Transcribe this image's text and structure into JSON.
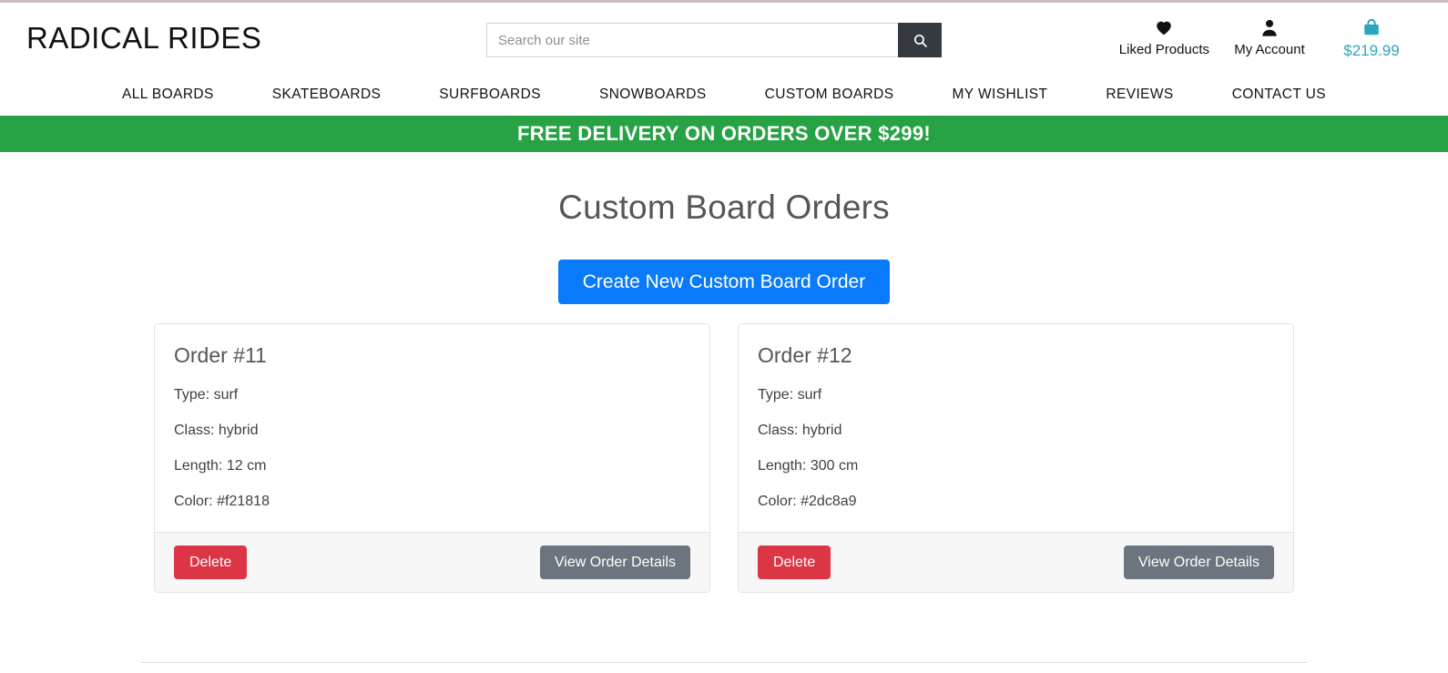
{
  "brand": {
    "name": "RADICAL RIDES"
  },
  "search": {
    "placeholder": "Search our site",
    "value": "",
    "button_icon": "search-icon"
  },
  "header_actions": [
    {
      "icon": "heart-icon",
      "label": "Liked Products"
    },
    {
      "icon": "user-icon",
      "label": "My Account"
    },
    {
      "icon": "shopping-bag-icon",
      "label": "$219.99",
      "color": "#2ba6bf"
    }
  ],
  "nav": {
    "items": [
      {
        "label": "ALL BOARDS"
      },
      {
        "label": "SKATEBOARDS"
      },
      {
        "label": "SURFBOARDS"
      },
      {
        "label": "SNOWBOARDS"
      },
      {
        "label": "CUSTOM BOARDS"
      },
      {
        "label": "MY WISHLIST"
      },
      {
        "label": "REVIEWS"
      },
      {
        "label": "CONTACT US"
      }
    ]
  },
  "banner": {
    "text": "FREE DELIVERY ON ORDERS OVER $299!",
    "background": "#27a244"
  },
  "main": {
    "title": "Custom Board Orders",
    "create_button": {
      "label": "Create New Custom Board Order",
      "color": "#097afa"
    }
  },
  "orders": [
    {
      "title": "Order #11",
      "type": "Type: surf",
      "class": "Class: hybrid",
      "length": "Length: 12 cm",
      "color": "Color: #f21818",
      "delete_label": "Delete",
      "view_label": "View Order Details"
    },
    {
      "title": "Order #12",
      "type": "Type: surf",
      "class": "Class: hybrid",
      "length": "Length: 300 cm",
      "color": "Color: #2dc8a9",
      "delete_label": "Delete",
      "view_label": "View Order Details"
    }
  ],
  "colors": {
    "delete_button": "#dc3545",
    "view_button": "#6c757d",
    "search_button": "#343a40",
    "title_text": "#565656"
  }
}
